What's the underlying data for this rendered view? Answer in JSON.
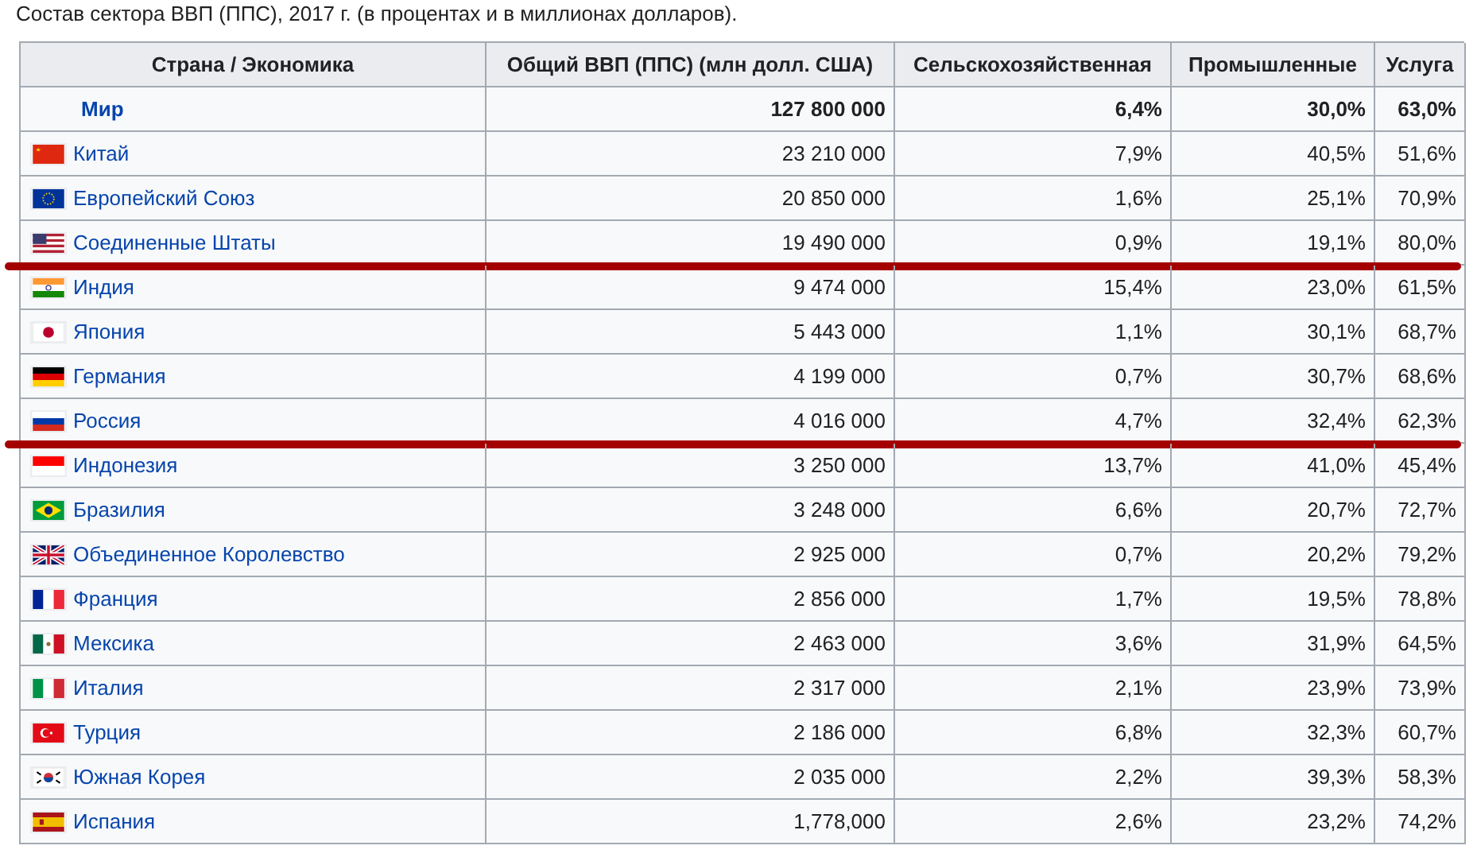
{
  "caption": "Состав сектора ВВП (ППС), 2017 г. (в процентах и в миллионах долларов).",
  "table": {
    "columns": [
      "Страна / Экономика",
      "Общий ВВП (ППС) (млн долл. США)",
      "Сельскохозяйственная",
      "Промышленные",
      "Услуга"
    ],
    "rows": [
      {
        "kind": "total",
        "name": "Мир",
        "gdp": "127 800 000",
        "agri": "6,4%",
        "ind": "30,0%",
        "serv": "63,0%",
        "underlined": false
      },
      {
        "kind": "cn",
        "name": "Китай",
        "gdp": "23 210 000",
        "agri": "7,9%",
        "ind": "40,5%",
        "serv": "51,6%",
        "underlined": false
      },
      {
        "kind": "eu",
        "name": "Европейский Союз",
        "gdp": "20 850 000",
        "agri": "1,6%",
        "ind": "25,1%",
        "serv": "70,9%",
        "underlined": false
      },
      {
        "kind": "us",
        "name": "Соединенные Штаты",
        "gdp": "19 490 000",
        "agri": "0,9%",
        "ind": "19,1%",
        "serv": "80,0%",
        "underlined": true
      },
      {
        "kind": "in",
        "name": "Индия",
        "gdp": "9 474 000",
        "agri": "15,4%",
        "ind": "23,0%",
        "serv": "61,5%",
        "underlined": false
      },
      {
        "kind": "jp",
        "name": "Япония",
        "gdp": "5 443 000",
        "agri": "1,1%",
        "ind": "30,1%",
        "serv": "68,7%",
        "underlined": false
      },
      {
        "kind": "de",
        "name": "Германия",
        "gdp": "4 199 000",
        "agri": "0,7%",
        "ind": "30,7%",
        "serv": "68,6%",
        "underlined": false
      },
      {
        "kind": "ru",
        "name": "Россия",
        "gdp": "4 016 000",
        "agri": "4,7%",
        "ind": "32,4%",
        "serv": "62,3%",
        "underlined": true
      },
      {
        "kind": "id",
        "name": "Индонезия",
        "gdp": "3 250 000",
        "agri": "13,7%",
        "ind": "41,0%",
        "serv": "45,4%",
        "underlined": false
      },
      {
        "kind": "br",
        "name": "Бразилия",
        "gdp": "3 248 000",
        "agri": "6,6%",
        "ind": "20,7%",
        "serv": "72,7%",
        "underlined": false
      },
      {
        "kind": "gb",
        "name": "Объединенное Королевство",
        "gdp": "2 925 000",
        "agri": "0,7%",
        "ind": "20,2%",
        "serv": "79,2%",
        "underlined": false
      },
      {
        "kind": "fr",
        "name": "Франция",
        "gdp": "2 856 000",
        "agri": "1,7%",
        "ind": "19,5%",
        "serv": "78,8%",
        "underlined": false
      },
      {
        "kind": "mx",
        "name": "Мексика",
        "gdp": "2 463 000",
        "agri": "3,6%",
        "ind": "31,9%",
        "serv": "64,5%",
        "underlined": false
      },
      {
        "kind": "it",
        "name": "Италия",
        "gdp": "2 317 000",
        "agri": "2,1%",
        "ind": "23,9%",
        "serv": "73,9%",
        "underlined": false
      },
      {
        "kind": "tr",
        "name": "Турция",
        "gdp": "2 186 000",
        "agri": "6,8%",
        "ind": "32,3%",
        "serv": "60,7%",
        "underlined": false
      },
      {
        "kind": "kr",
        "name": "Южная Корея",
        "gdp": "2 035 000",
        "agri": "2,2%",
        "ind": "39,3%",
        "serv": "58,3%",
        "underlined": false
      },
      {
        "kind": "es",
        "name": "Испания",
        "gdp": "1,778,000",
        "agri": "2,6%",
        "ind": "23,2%",
        "serv": "74,2%",
        "underlined": false
      }
    ]
  }
}
